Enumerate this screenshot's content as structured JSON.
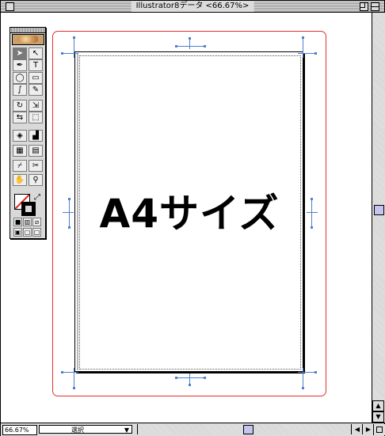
{
  "window": {
    "title": "Illustrator8データ <66.67%>"
  },
  "document": {
    "artboard_text": "A4サイズ"
  },
  "toolbox": {
    "tools": [
      {
        "name": "selection-tool",
        "glyph": "➤"
      },
      {
        "name": "direct-selection-tool",
        "glyph": "↖"
      },
      {
        "name": "pen-tool",
        "glyph": "✒"
      },
      {
        "name": "type-tool",
        "glyph": "T"
      },
      {
        "name": "ellipse-tool",
        "glyph": "◯"
      },
      {
        "name": "rectangle-tool",
        "glyph": "▭"
      },
      {
        "name": "paintbrush-tool",
        "glyph": "∫"
      },
      {
        "name": "pencil-tool",
        "glyph": "✎"
      },
      {
        "name": "rotate-tool",
        "glyph": "↻"
      },
      {
        "name": "scale-tool",
        "glyph": "⇲"
      },
      {
        "name": "reflect-tool",
        "glyph": "⇆"
      },
      {
        "name": "free-transform-tool",
        "glyph": "⬚"
      },
      {
        "name": "blend-tool",
        "glyph": "◈"
      },
      {
        "name": "graph-tool",
        "glyph": "▟"
      },
      {
        "name": "gradient-mesh-tool",
        "glyph": "▦"
      },
      {
        "name": "gradient-tool",
        "glyph": "▤"
      },
      {
        "name": "eyedropper-tool",
        "glyph": "⌿"
      },
      {
        "name": "scissors-tool",
        "glyph": "✂"
      },
      {
        "name": "hand-tool",
        "glyph": "✋"
      },
      {
        "name": "zoom-tool",
        "glyph": "⚲"
      }
    ],
    "color_modes": [
      {
        "name": "color-mode-icon",
        "glyph": "■"
      },
      {
        "name": "gradient-mode-icon",
        "glyph": "▥"
      },
      {
        "name": "none-mode-icon",
        "glyph": "⧄"
      }
    ],
    "screen_modes": [
      {
        "name": "standard-screen-mode-icon",
        "glyph": "▣"
      },
      {
        "name": "full-screen-menu-mode-icon",
        "glyph": "▢"
      },
      {
        "name": "full-screen-mode-icon",
        "glyph": "□"
      }
    ]
  },
  "statusbar": {
    "zoom": "66.67%",
    "mode": "選択"
  },
  "colors": {
    "frame": "#e43030",
    "cropmarks": "#4f7fd0",
    "scroll_thumb": "#c5c5f0"
  }
}
